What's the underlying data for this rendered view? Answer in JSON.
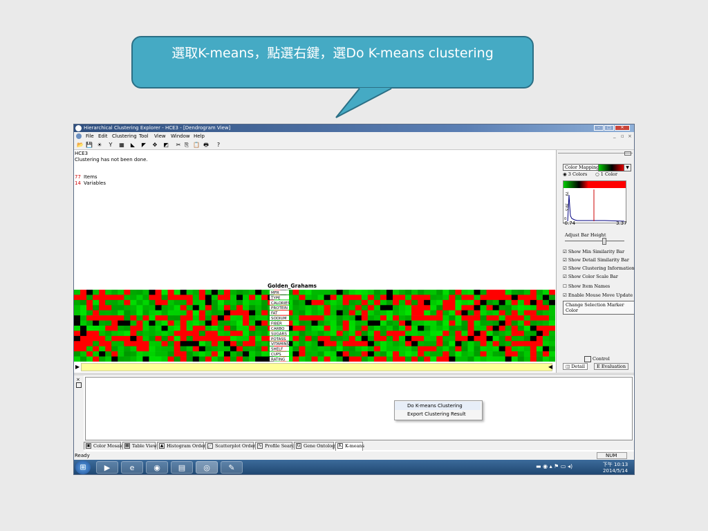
{
  "callout": {
    "text": "選取K-means，點選右鍵，選Do K-means clustering"
  },
  "window": {
    "title": "Hierarchical Clustering Explorer - HCE3 - [Dendrogram View]",
    "controls": {
      "minimize": "–",
      "maximize": "□",
      "close": "✕",
      "mdi_min": "_",
      "mdi_restore": "▫",
      "mdi_close": "×"
    }
  },
  "menu": [
    "File",
    "Edit",
    "Clustering",
    "Tool",
    "View",
    "Window",
    "Help"
  ],
  "toolbar": {
    "icons": [
      "open-icon",
      "save-icon",
      "sun-icon",
      "cluster-icon",
      "chart-icon",
      "flag-red-icon",
      "flag-blue-icon",
      "arrows-icon",
      "filter-icon",
      "cut-icon",
      "copy-icon",
      "paste-icon",
      "print-icon",
      "help-icon"
    ],
    "glyphs": [
      "📂",
      "💾",
      "☀",
      "Y",
      "▦",
      "◣",
      "◤",
      "✥",
      "◩",
      "✂",
      "⎘",
      "📋",
      "🖶",
      "?"
    ]
  },
  "info": {
    "name": "HCE3",
    "status": "Clustering has not been done.",
    "items_count": "77",
    "items_label": "Items",
    "variables_count": "14",
    "variables_label": "Variables"
  },
  "heatmap": {
    "highlighted_item": "Golden_Grahams",
    "row_labels": [
      "MFR",
      "TYPE",
      "CALORIES",
      "PROTEIN",
      "FAT",
      "SODIUM",
      "FIBER",
      "CARBO",
      "SUGARS",
      "POTASS",
      "VITAMINS",
      "SHELF",
      "CUPS",
      "RATING"
    ],
    "colors": {
      "high": "#ff0000",
      "mid": "#000000",
      "low": "#00cc00"
    }
  },
  "right_panel": {
    "color_mapping_label": "Color Mapping",
    "radio_3": "3 Colors",
    "radio_1": "1 Color",
    "histo_ticks": [
      "79",
      "39.5",
      "0"
    ],
    "range_min": "-0.74",
    "range_max": "3.37",
    "adjust_label": "Adjust Bar Height",
    "checkboxes": [
      {
        "label": "Show Min Similarity Bar",
        "checked": true
      },
      {
        "label": "Show Detail Similarity Bar",
        "checked": true
      },
      {
        "label": "Show Clustering Information",
        "checked": true
      },
      {
        "label": "Show Color Scale Bar",
        "checked": true
      },
      {
        "label": "Show Item Names",
        "checked": false
      },
      {
        "label": "Enable Mouse Move Update",
        "checked": true
      }
    ],
    "marker_button": "Change Selection Marker Color",
    "control_label": "Control",
    "detail_tab": "Detail",
    "evaluation_tab": "Evaluation"
  },
  "context_menu": [
    "Do K-means Clustering",
    "Export Clustering Result"
  ],
  "tabs": [
    "Color Mosaic",
    "Table View",
    "Histogram Ordering",
    "Scatterplot Ordering",
    "Profile Search",
    "Gene Ontology",
    "K-means"
  ],
  "tab_icons": [
    "▣",
    "▦",
    "▲",
    "⋰",
    "∿",
    "G",
    "K"
  ],
  "statusbar": {
    "left": "Ready",
    "num": "NUM"
  },
  "taskbar": {
    "apps": [
      "start-orb-icon",
      "media-icon",
      "ie-icon",
      "chrome-icon",
      "explorer-icon",
      "hce-eye-icon",
      "paint-icon"
    ],
    "app_glyphs": [
      "⊞",
      "▶",
      "e",
      "◉",
      "▤",
      "◎",
      "✎"
    ],
    "time": "下午 10:13",
    "date": "2014/5/14"
  }
}
